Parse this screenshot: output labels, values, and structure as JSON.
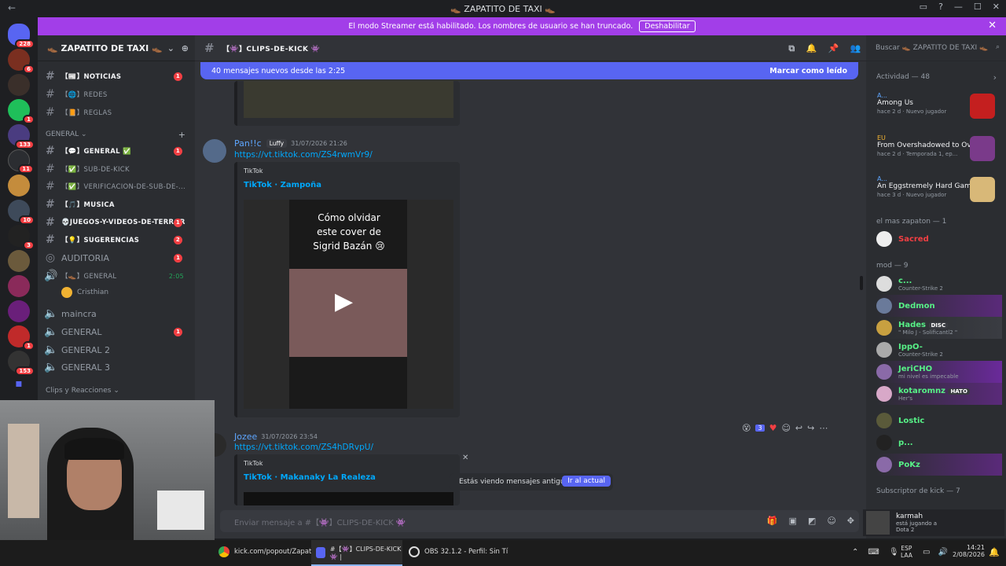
{
  "window": {
    "title": "👞 ZAPATITO DE TAXI 👞"
  },
  "streamer_bar": {
    "text": "El modo Streamer está habilitado. Los nombres de usuario se han truncado.",
    "button": "Deshabilitar"
  },
  "guild_badges": [
    "228",
    "6",
    "1",
    "133",
    "11",
    "10",
    "3",
    "1",
    "153"
  ],
  "server": {
    "name": "👞 ZAPATITO DE TAXI 👞"
  },
  "channels": [
    {
      "name": "【📰】NOTICIAS",
      "unread": "1",
      "bright": true
    },
    {
      "name": "【🌐】REDES",
      "unread": "",
      "bright": false
    },
    {
      "name": "【📙】REGLAS",
      "unread": "",
      "bright": false
    }
  ],
  "category_general": "GENERAL",
  "channels_general": [
    {
      "name": "【💬】GENERAL ✅",
      "unread": "1",
      "bright": true
    },
    {
      "name": "【✅】SUB-DE-KICK",
      "unread": "",
      "bright": false
    },
    {
      "name": "【✅】VERIFICACION-DE-SUB-DE-...",
      "unread": "",
      "bright": false
    },
    {
      "name": "【🎵】MUSICA",
      "unread": "",
      "bright": true
    },
    {
      "name": "💀JUEGOS-Y-VIDEOS-DE-TERROR",
      "unread": "1",
      "bright": true
    },
    {
      "name": "【💡】SUGERENCIAS",
      "unread": "2",
      "bright": true
    }
  ],
  "voice": [
    {
      "name": "AUDITORIA",
      "unread": "1"
    },
    {
      "name": "【👞】GENERAL",
      "time": "2:05",
      "user": "Cristhian"
    },
    {
      "name": "maincra",
      "unread": ""
    },
    {
      "name": "GENERAL",
      "unread": "1"
    },
    {
      "name": "GENERAL 2",
      "unread": ""
    },
    {
      "name": "GENERAL 3",
      "unread": ""
    }
  ],
  "category_clips": "Clips y Reacciones",
  "chat": {
    "channel": "【👾】CLIPS-DE-KICK 👾",
    "new_messages": "40 mensajes nuevos desde las 2:25",
    "mark_read": "Marcar como leído",
    "msg1": {
      "user": "Pan!!c",
      "tag": "Luffy",
      "time": "31/07/2026 21:26",
      "link": "https://vt.tiktok.com/ZS4rwmVr9/",
      "provider": "TikTok",
      "embed_title": "TikTok · Zampoña",
      "video_caption": "Cómo olvidar este cover de Sigrid Bazán 😢"
    },
    "msg2": {
      "user": "Jozee",
      "time": "31/07/2026 23:54",
      "link": "https://vt.tiktok.com/ZS4hDRvpU/",
      "provider": "TikTok",
      "embed_title": "TikTok · Makanaky La Realeza",
      "reaction_count": "3"
    },
    "old_messages": "Estás viendo mensajes antiguos",
    "jump": "Ir al actual",
    "composer_placeholder": "Enviar mensaje a #【👾】CLIPS-DE-KICK 👾"
  },
  "members": {
    "search": "Buscar 👞 ZAPATITO DE TAXI 👞",
    "activity_header": "Actividad — 48",
    "activities": [
      {
        "user": "A...",
        "title": "Among Us",
        "when": "hace 2 d",
        "badge": "Nuevo jugador"
      },
      {
        "user": "EU",
        "title": "From Overshadowed to Ov...",
        "when": "hace 2 d",
        "badge": "Temporada 1, ep..."
      },
      {
        "user": "A...",
        "title": "An Eggstremely Hard Game",
        "when": "hace 3 d",
        "badge": "Nuevo jugador"
      }
    ],
    "sec1": "el mas zapaton — 1",
    "sec1_members": [
      {
        "name": "Sacred",
        "status": "",
        "color": "#f23f43"
      }
    ],
    "sec2": "mod — 9",
    "sec2_members": [
      {
        "name": "c...",
        "status": "Counter-Strike 2",
        "color": "#3ba55c"
      },
      {
        "name": "Dedmon",
        "status": "",
        "color": "#57f287"
      },
      {
        "name": "Hades",
        "status": "\" Milo J - Solificantl2 \"",
        "color": "#57f287",
        "tag": "DISC"
      },
      {
        "name": "IppO-",
        "status": "Counter-Strike 2",
        "color": "#57f287"
      },
      {
        "name": "JeriCHO",
        "status": "mi nivel es impecable",
        "color": "#57f287"
      },
      {
        "name": "kotaromnz",
        "status": "Her's",
        "color": "#57f287",
        "tag": "HATO"
      },
      {
        "name": "Lostic",
        "status": "",
        "color": "#57f287"
      },
      {
        "name": "p...",
        "status": "",
        "color": "#57f287"
      },
      {
        "name": "PoKz",
        "status": "",
        "color": "#57f287"
      }
    ],
    "sec3": "Subscriptor de kick — 7"
  },
  "user_panel": {
    "name": "karmah",
    "line1": "está jugando a",
    "line2": "Dota 2"
  },
  "taskbar": {
    "items": [
      "kick.com/popout/Zapat",
      "#【👾】CLIPS-DE-KICK 👾 |",
      "OBS 32.1.2 - Perfil: Sin Tí"
    ],
    "lang1": "ESP",
    "lang2": "LAA",
    "time": "14:21",
    "date": "2/08/2026"
  }
}
